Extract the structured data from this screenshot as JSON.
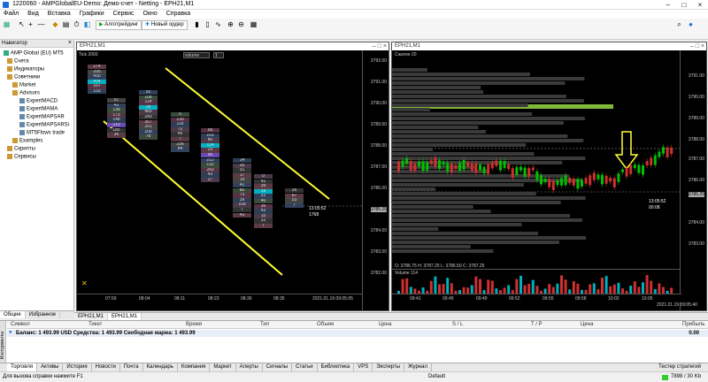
{
  "titlebar": {
    "title": "1220060 - AMPGlobalEU-Demo: Демо-счет - Netting - EPH21,M1"
  },
  "menu": [
    "Файл",
    "Вид",
    "Вставка",
    "Графики",
    "Сервис",
    "Окно",
    "Справка"
  ],
  "toolbar": {
    "algo_label": "Алготрейдинг",
    "new_order_label": "Новый ордер"
  },
  "navigator": {
    "title": "Навигатор",
    "items": [
      "AMP Global (EU) MT5",
      "Счета",
      "Индикаторы",
      "Советники",
      "Market",
      "Advisors",
      "ExpertMACD",
      "ExpertMAMA",
      "ExpertMAPSAR",
      "ExpertMAPSARSi",
      "MT5Flows trade",
      "Examples",
      "Скрипты",
      "Сервисы"
    ],
    "tabs": [
      "Общие",
      "Избранное"
    ]
  },
  "chart_left": {
    "title": "EPH21,M1",
    "toolbar": {
      "tick_label": "Tick 2000",
      "mode": "volume",
      "value": "1"
    },
    "prices": [
      "3792.00",
      "3791.00",
      "3790.00",
      "3789.00",
      "3788.00",
      "3787.00",
      "3786.00",
      "3785.25",
      "3784.00",
      "3783.00",
      "3782.00"
    ],
    "last_price": "3785.25",
    "time_label": "13:05:52",
    "count_label": "1768",
    "times": [
      "07:59",
      "08:04",
      "08:11",
      "08:23",
      "08:30",
      "08:35"
    ],
    "date_label": "2021.01.19 09:05:05",
    "footprint": [
      [
        "174",
        "295",
        "430",
        "434",
        "167",
        "133"
      ],
      [
        "57",
        "41",
        "138",
        "173",
        "148",
        "210",
        "185",
        "36"
      ],
      [
        "55",
        "108",
        "114",
        "28",
        "483",
        "243",
        "367",
        "201",
        "109",
        "78"
      ],
      [
        "5",
        "139",
        "116",
        "72",
        "45",
        "7",
        "236",
        "84"
      ],
      [
        "58",
        "103",
        "80",
        "114",
        "23",
        "96",
        "212",
        "132",
        "283",
        "43",
        "27"
      ],
      [
        "14",
        "26",
        "31",
        "17",
        "19",
        "41",
        "80",
        "73",
        "39",
        "109",
        "7",
        "43"
      ],
      [
        "0",
        "41",
        "39",
        "18",
        "21",
        "40",
        "36",
        "42",
        "15",
        "22",
        "7"
      ],
      [
        "26",
        "67",
        "53",
        "7"
      ]
    ]
  },
  "chart_right": {
    "title": "EPH21,M1",
    "toolbar_label": "Сжатие 20",
    "prices": [
      "3791.00",
      "3790.00",
      "3789.00",
      "3788.00",
      "3787.00",
      "3786.00",
      "3785.25",
      "3784.00",
      "3783.00"
    ],
    "last_price": "3785.25",
    "time_label": "13:05:52",
    "count_label": "00:08",
    "ohlc_line": "O: 3786.75  H: 3787.25  L: 3786.50  C: 3787.25",
    "volume_label": "Volume 114",
    "times": [
      "09:41",
      "09:45",
      "09:49",
      "09:52",
      "09:55",
      "09:58",
      "10:02",
      "10:05"
    ],
    "date_label": "2021.01.19 09:05:40"
  },
  "chart_tabs": [
    "EPH21,M1",
    "EPH21,M1"
  ],
  "toolbox": {
    "columns": [
      "Символ",
      "Тикет",
      "Время",
      "Тип",
      "Объем",
      "Цена",
      "S / L",
      "T / P",
      "Цена",
      "Прибыль"
    ],
    "balance_line": "Баланс: 1 493.99 USD  Средства: 1 493.99  Свободная маржа: 1 493.99",
    "profit": "0.00",
    "side_label": "Инструменты"
  },
  "bottom_tabs": [
    "Торговля",
    "Активы",
    "История",
    "Новости",
    "Почта",
    "Календарь",
    "Компания",
    "Маркет",
    "Алерты",
    "Сигналы",
    "Статьи",
    "Библиотека",
    "VPS",
    "Эксперты",
    "Журнал"
  ],
  "bottom_right": "Тестер стратегий",
  "status": {
    "help": "Для вызова справки нажмите F1",
    "profile": "Default",
    "traffic": "7898 / 30 Kb"
  },
  "colors": {
    "accent_yellow": "#ffff33",
    "up_green": "#00c000",
    "down_red": "#d03030",
    "cyan": "#00b0c0"
  }
}
